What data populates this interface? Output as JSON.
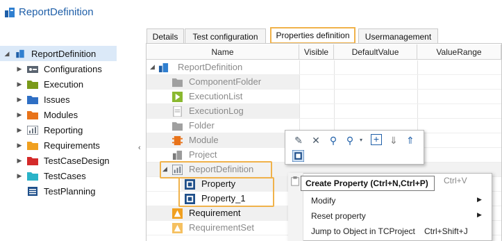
{
  "app": {
    "title": "ReportDefinition",
    "icon": "report-definition-icon"
  },
  "tree": {
    "root": {
      "label": "ReportDefinition",
      "icon": "report-definition-icon"
    },
    "items": [
      {
        "label": "Configurations",
        "icon": "configurations-icon",
        "color": "#5a6470"
      },
      {
        "label": "Execution",
        "icon": "execution-folder-icon",
        "color": "#7a9a1a"
      },
      {
        "label": "Issues",
        "icon": "issues-folder-icon",
        "color": "#2f6fc4"
      },
      {
        "label": "Modules",
        "icon": "modules-folder-icon",
        "color": "#e8731a"
      },
      {
        "label": "Reporting",
        "icon": "reporting-icon",
        "color": "#6a7480"
      },
      {
        "label": "Requirements",
        "icon": "requirements-folder-icon",
        "color": "#f0a020"
      },
      {
        "label": "TestCaseDesign",
        "icon": "testcasedesign-folder-icon",
        "color": "#d42a2a"
      },
      {
        "label": "TestCases",
        "icon": "testcases-folder-icon",
        "color": "#2ab3c8"
      },
      {
        "label": "TestPlanning",
        "icon": "testplanning-icon",
        "color": "#1f4f8a"
      }
    ]
  },
  "tabs": [
    {
      "label": "Details"
    },
    {
      "label": "Test configuration"
    },
    {
      "label": "Properties definition",
      "active": true
    },
    {
      "label": "Usermanagement"
    }
  ],
  "grid": {
    "columns": [
      "Name",
      "Visible",
      "DefaultValue",
      "ValueRange"
    ],
    "rows": [
      {
        "label": "ReportDefinition",
        "icon": "report-definition-icon",
        "expanded": true
      },
      {
        "label": "ComponentFolder",
        "icon": "folder-icon"
      },
      {
        "label": "ExecutionList",
        "icon": "execution-list-icon"
      },
      {
        "label": "ExecutionLog",
        "icon": "execution-log-icon"
      },
      {
        "label": "Folder",
        "icon": "folder-icon"
      },
      {
        "label": "Module",
        "icon": "module-icon"
      },
      {
        "label": "Project",
        "icon": "project-icon"
      },
      {
        "label": "ReportDefinition",
        "icon": "report-icon",
        "expanded": true
      },
      {
        "label": "Property",
        "icon": "property-icon"
      },
      {
        "label": "Property_1",
        "icon": "property-icon"
      },
      {
        "label": "Requirement",
        "icon": "requirement-icon"
      },
      {
        "label": "RequirementSet",
        "icon": "requirementset-icon"
      }
    ]
  },
  "mini_toolbar": {
    "buttons": [
      "edit-icon",
      "delete-icon",
      "search-icon",
      "search-dropdown-icon",
      "add-icon",
      "collapse-all-icon",
      "expand-all-icon",
      "property-icon"
    ]
  },
  "context_menu": {
    "tooltip": "Create Property (Ctrl+N,Ctrl+P)",
    "paste_shortcut": "Ctrl+V",
    "items": [
      {
        "label": "Modify",
        "submenu": true
      },
      {
        "label": "Reset property",
        "submenu": true
      },
      {
        "label": "Jump to Object in TCProject",
        "shortcut": "Ctrl+Shift+J"
      }
    ]
  },
  "colors": {
    "accent": "#1f5fa8",
    "highlight": "#f0b24a"
  }
}
